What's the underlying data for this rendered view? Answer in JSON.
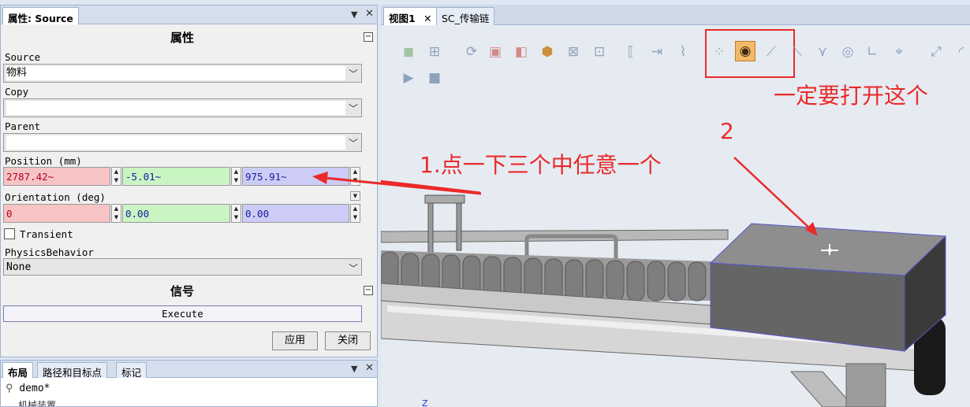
{
  "props_panel": {
    "tab": "属性: Source",
    "section_title": "属性",
    "source_label": "Source",
    "source_value": "物料",
    "copy_label": "Copy",
    "copy_value": "",
    "parent_label": "Parent",
    "parent_value": "",
    "position_label": "Position (mm)",
    "position": [
      "2787.42~",
      "-5.01~",
      "975.91~"
    ],
    "orientation_label": "Orientation (deg)",
    "orientation": [
      "0",
      "0.00",
      "0.00"
    ],
    "transient_label": "Transient",
    "physics_label": "PhysicsBehavior",
    "physics_value": "None",
    "signal_title": "信号",
    "execute_label": "Execute",
    "apply_label": "应用",
    "close_label": "关闭"
  },
  "layout_panel": {
    "tabs": [
      "布局",
      "路径和目标点",
      "标记"
    ],
    "tree_item": "demo*",
    "tree_sub": "机械装置"
  },
  "view": {
    "tabs": [
      "视图1",
      "SC_传输链"
    ],
    "axis_label": "Z"
  },
  "annotations": {
    "top_right": "一定要打开这个",
    "step1": "1.点一下三个中任意一个",
    "step2": "2"
  },
  "colors": {
    "annotation": "#ea2a2a",
    "pos_x": "#f7c4c6",
    "pos_y": "#c9f5c3",
    "pos_z": "#ccccf6"
  }
}
